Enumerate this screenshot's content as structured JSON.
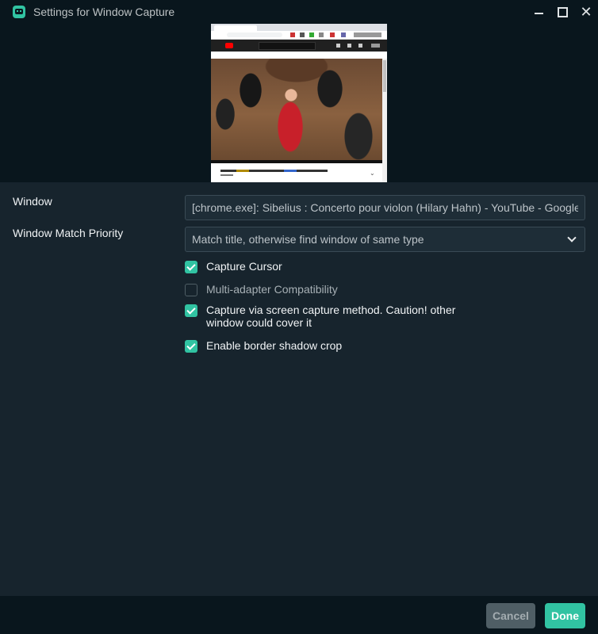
{
  "window": {
    "title": "Settings for Window Capture"
  },
  "colors": {
    "accent": "#31c3a2",
    "background": "#17242d",
    "titlebar": "#09161d"
  },
  "icons": {
    "app": "streamlabs-icon",
    "minimize": "minimize-icon",
    "maximize": "maximize-icon",
    "close": "close-icon",
    "dropdown": "chevron-down-icon",
    "check": "checkmark-icon"
  },
  "form": {
    "window_label": "Window",
    "window_value": "[chrome.exe]: Sibelius : Concerto pour violon (Hilary Hahn) - YouTube - Google Chrome",
    "priority_label": "Window Match Priority",
    "priority_value": "Match title, otherwise find window of same type"
  },
  "checkboxes": [
    {
      "label": "Capture Cursor",
      "checked": true
    },
    {
      "label": "Multi-adapter Compatibility",
      "checked": false
    },
    {
      "label": "Capture via screen capture method. Caution! other window could cover it",
      "checked": true
    },
    {
      "label": "Enable border shadow crop",
      "checked": true
    }
  ],
  "footer": {
    "cancel_label": "Cancel",
    "done_label": "Done"
  }
}
